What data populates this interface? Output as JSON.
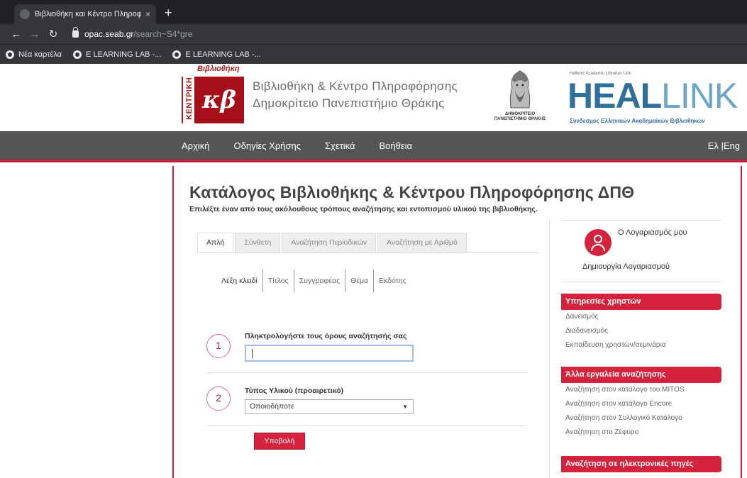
{
  "browser": {
    "tab_title": "Βιβλιοθήκη και Κέντρο Πληροφό",
    "tab_close": "×",
    "new_tab": "+",
    "url_host": "opac.seab.gr",
    "url_path": "/search~S4*gre",
    "bookmarks": [
      "Νέα καρτέλα",
      "E LEARNING LAB -...",
      "E LEARNING LAB -..."
    ]
  },
  "header": {
    "logo_top": "Βιβλιοθήκη",
    "logo_vertical": "ΚΕΝΤΡΙΚΗ",
    "logo_letters": "κβ",
    "title_line1": "Βιβλιοθήκη & Κέντρο Πληροφόρησης",
    "title_line2": "Δημοκρίτειο Πανεπιστήμιο Θράκης",
    "bust_caption": "ΔΗΜΟΚΡΙΤΕΙΟ ΠΑΝΕΠΙΣΤΗΜΙΟ ΘΡΑΚΗΣ",
    "heallink_small": "Hellenic Academic Libraries Link",
    "heallink_bold": "HEAL",
    "heallink_thin": "LINK",
    "heallink_sub": "Σύνδεσμος Ελληνικών Ακαδημαϊκών Βιβλιοθηκών"
  },
  "nav": {
    "items": [
      "Αρχική",
      "Οδηγίες Χρήσης",
      "Σχετικά",
      "Βοήθεια"
    ],
    "lang": "Ελ |Eng"
  },
  "main": {
    "title": "Κατάλογος Βιβλιοθήκης & Κέντρου Πληροφόρησης ΔΠΘ",
    "subtitle": "Επιλέξτε έναν από τους ακόλουθους τρόπους αναζήτησης και εντοπισμού υλικού της βιβλιοθήκης.",
    "tabs": [
      "Απλή",
      "Σύνθετη",
      "Αναζήτηση Περιοδικών",
      "Αναζήτηση με Αριθμό"
    ],
    "subtabs": [
      "Λέξη κλειδί",
      "Τίτλος",
      "Συγγραφέας",
      "Θέμα",
      "Εκδότης"
    ],
    "step1_number": "1",
    "step1_label": "Πληκτρολογήστε τους όρους αναζήτησής σας",
    "search_value": "",
    "step2_number": "2",
    "step2_label": "Τύπος Υλικού (προαιρετικό)",
    "material_selected": "Οποιοδήποτε",
    "submit_label": "Υποβολή"
  },
  "sidebar": {
    "account_label": "Ο Λογαριασμός μου",
    "create_account": "Δημιουργία Λογαριασμού",
    "section1_title": "Υπηρεσίες χρηστών",
    "section1_links": [
      "Δανεισμός",
      "Διαδανεισμός",
      "Εκπαίδευση χρηστών/σεμινάρια"
    ],
    "section2_title": "Άλλα εργαλεία αναζήτησης",
    "section2_links": [
      "Αναζήτηση στον κατάλογο του MITOS",
      "Αναζήτηση στον κατάλογο Encore",
      "Αναζήτηση στον Συλλογικό Κατάλογο",
      "Αναζήτηση στο Ζέφυρο"
    ],
    "section3_title": "Αναζήτηση σε ηλεκτρονικές πηγές"
  },
  "colors": {
    "accent": "#d5223d",
    "nav_bg": "#555555",
    "chrome_bg": "#35363a"
  }
}
